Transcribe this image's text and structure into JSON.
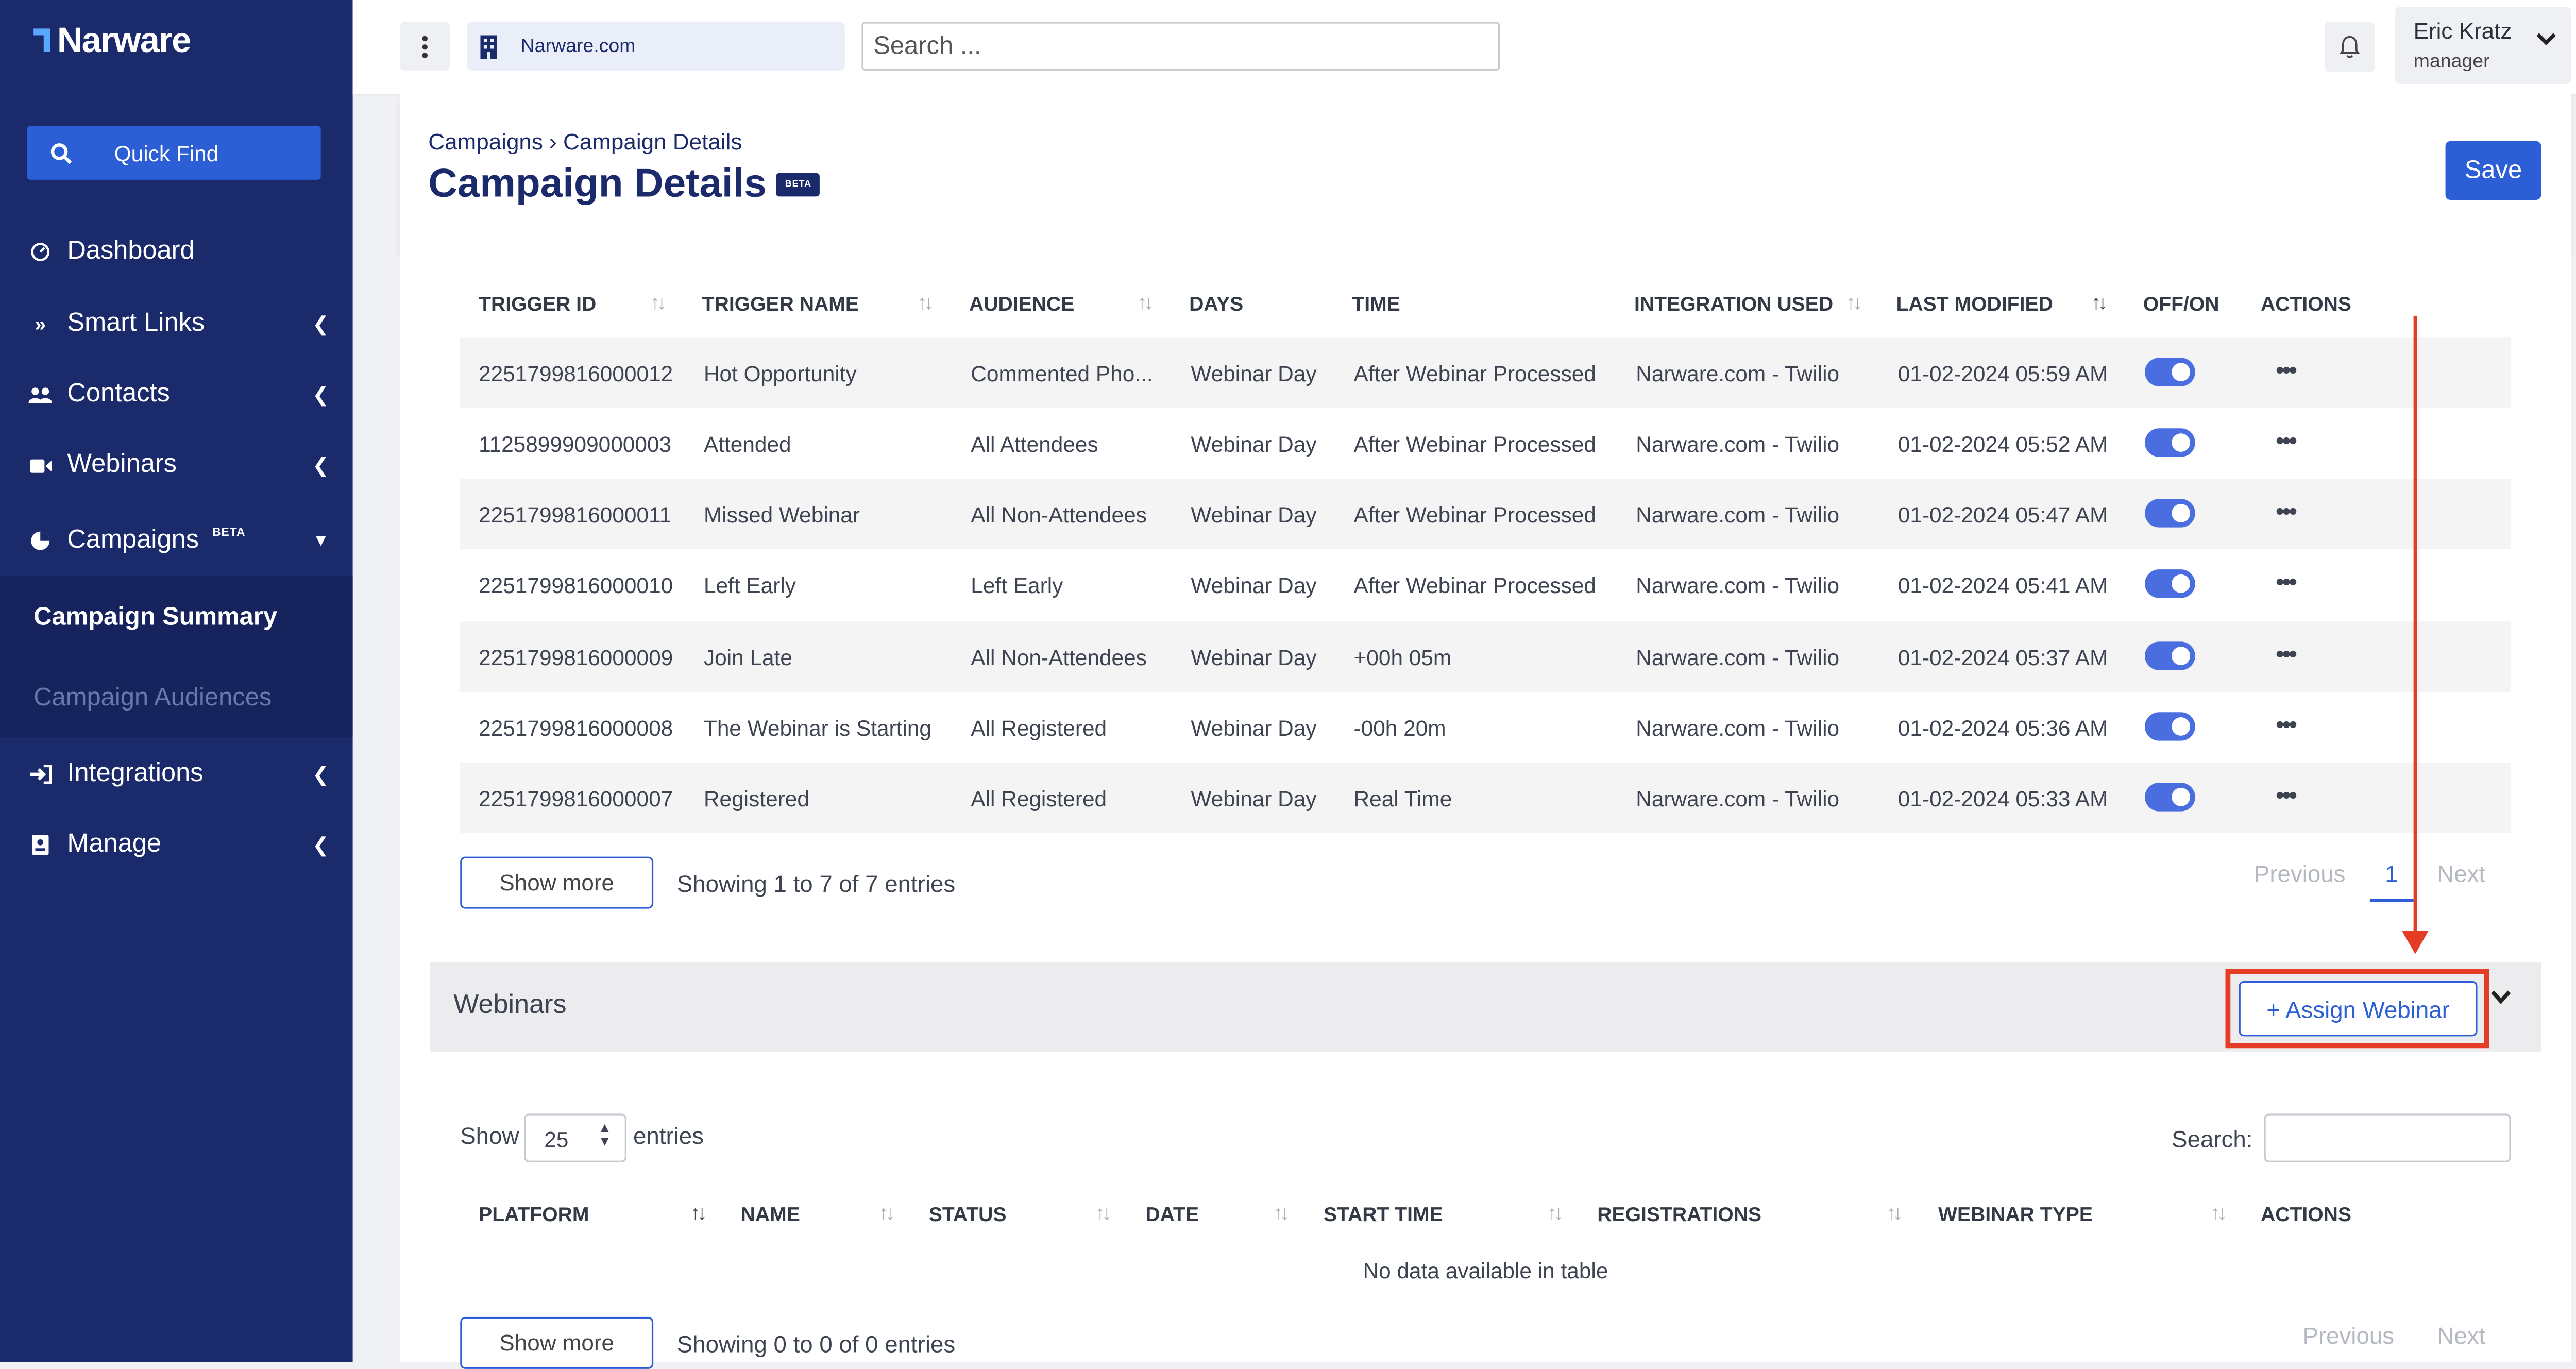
{
  "app": {
    "logo": "Narware",
    "quick_find": "Quick Find",
    "org_name": "Narware.com",
    "search_placeholder": "Search ...",
    "user": {
      "name": "Eric Kratz",
      "role": "manager"
    },
    "accent_color": "#2c5fd6",
    "sidebar_color": "#1b2a6b"
  },
  "sidebar": {
    "items": [
      {
        "label": "Dashboard",
        "icon": "dashboard-icon"
      },
      {
        "label": "Smart Links",
        "icon": "double-chevron-icon"
      },
      {
        "label": "Contacts",
        "icon": "users-icon"
      },
      {
        "label": "Webinars",
        "icon": "video-icon"
      },
      {
        "label": "Campaigns",
        "icon": "pie-chart-icon",
        "badge": "BETA"
      },
      {
        "label": "Integrations",
        "icon": "sign-in-icon"
      },
      {
        "label": "Manage",
        "icon": "id-card-icon"
      }
    ],
    "campaign_sub": [
      "Campaign Summary",
      "Campaign Audiences"
    ]
  },
  "header": {
    "breadcrumb": "Campaigns › Campaign Details",
    "title": "Campaign Details",
    "badge": "BETA",
    "save": "Save"
  },
  "triggers": {
    "columns": [
      "TRIGGER ID",
      "TRIGGER NAME",
      "AUDIENCE",
      "DAYS",
      "TIME",
      "INTEGRATION USED",
      "LAST MODIFIED",
      "OFF/ON",
      "ACTIONS"
    ],
    "rows": [
      {
        "id": "2251799816000012",
        "name": "Hot Opportunity",
        "audience": "Commented Pho...",
        "days": "Webinar Day",
        "time": "After Webinar Processed",
        "integration": "Narware.com - Twilio",
        "modified": "01-02-2024 05:59 AM",
        "on": true
      },
      {
        "id": "1125899909000003",
        "name": "Attended",
        "audience": "All Attendees",
        "days": "Webinar Day",
        "time": "After Webinar Processed",
        "integration": "Narware.com - Twilio",
        "modified": "01-02-2024 05:52 AM",
        "on": true
      },
      {
        "id": "2251799816000011",
        "name": "Missed Webinar",
        "audience": "All Non-Attendees",
        "days": "Webinar Day",
        "time": "After Webinar Processed",
        "integration": "Narware.com - Twilio",
        "modified": "01-02-2024 05:47 AM",
        "on": true
      },
      {
        "id": "2251799816000010",
        "name": "Left Early",
        "audience": "Left Early",
        "days": "Webinar Day",
        "time": "After Webinar Processed",
        "integration": "Narware.com - Twilio",
        "modified": "01-02-2024 05:41 AM",
        "on": true
      },
      {
        "id": "2251799816000009",
        "name": "Join Late",
        "audience": "All Non-Attendees",
        "days": "Webinar Day",
        "time": "+00h 05m",
        "integration": "Narware.com - Twilio",
        "modified": "01-02-2024 05:37 AM",
        "on": true
      },
      {
        "id": "2251799816000008",
        "name": "The Webinar is Starting",
        "audience": "All Registered",
        "days": "Webinar Day",
        "time": "-00h 20m",
        "integration": "Narware.com - Twilio",
        "modified": "01-02-2024 05:36 AM",
        "on": true
      },
      {
        "id": "2251799816000007",
        "name": "Registered",
        "audience": "All Registered",
        "days": "Webinar Day",
        "time": "Real Time",
        "integration": "Narware.com - Twilio",
        "modified": "01-02-2024 05:33 AM",
        "on": true
      }
    ],
    "show_more": "Show more",
    "info": "Showing 1 to 7 of 7 entries",
    "prev": "Previous",
    "page": "1",
    "next": "Next"
  },
  "webinars": {
    "title": "Webinars",
    "assign": "+ Assign Webinar",
    "show": "Show",
    "entries_value": "25",
    "entries": "entries",
    "search_label": "Search:",
    "columns": [
      "PLATFORM",
      "NAME",
      "STATUS",
      "DATE",
      "START TIME",
      "REGISTRATIONS",
      "WEBINAR TYPE",
      "ACTIONS"
    ],
    "empty": "No data available in table",
    "show_more": "Show more",
    "info": "Showing 0 to 0 of 0 entries",
    "prev": "Previous",
    "next": "Next"
  }
}
